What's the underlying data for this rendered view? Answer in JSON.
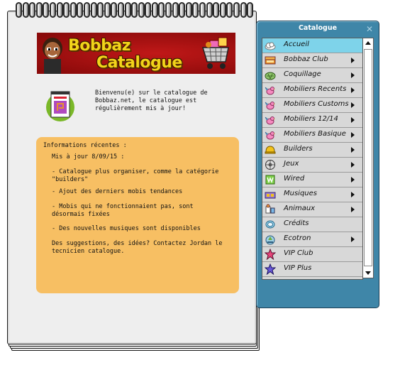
{
  "banner": {
    "title_line1": "Bobbaz",
    "title_line2": "Catalogue"
  },
  "intro": {
    "text": "Bienvenu(e) sur le catalogue de Bobbaz.net, le catalogue est régulièrement mis à jour!"
  },
  "news": {
    "title": "Informations récentes :",
    "date_line": "Mis à jour 8/09/15 :",
    "items": [
      "- Catalogue plus organiser, comme la catégorie \"builders\"",
      "- Ajout des derniers mobis tendances",
      "- Mobis qui ne fonctionnaient pas, sont désormais fixées",
      "- Des nouvelles musiques sont disponibles"
    ],
    "contact": "Des suggestions, des idées? Contactez Jordan le tecnicien catalogue."
  },
  "catalogue": {
    "title": "Catalogue",
    "close_icon": "close-icon",
    "accent_selected": "#7ed3ea",
    "window_color": "#3f86a8",
    "items": [
      {
        "label": "Accueil",
        "icon": "cloud-icon",
        "submenu": false,
        "selected": true
      },
      {
        "label": "Bobbaz Club",
        "icon": "club-sofa-icon",
        "submenu": true,
        "selected": false
      },
      {
        "label": "Coquillage",
        "icon": "shell-icon",
        "submenu": true,
        "selected": false
      },
      {
        "label": "Mobiliers Recents",
        "icon": "bird-icon",
        "submenu": true,
        "selected": false
      },
      {
        "label": "Mobiliers Customs",
        "icon": "bird-icon",
        "submenu": true,
        "selected": false
      },
      {
        "label": "Mobiliers 12/14",
        "icon": "bird-icon",
        "submenu": true,
        "selected": false
      },
      {
        "label": "Mobiliers Basique",
        "icon": "bird-icon",
        "submenu": true,
        "selected": false
      },
      {
        "label": "Builders",
        "icon": "builder-helmet-icon",
        "submenu": true,
        "selected": false
      },
      {
        "label": "Jeux",
        "icon": "ball-icon",
        "submenu": true,
        "selected": false
      },
      {
        "label": "Wired",
        "icon": "wired-icon",
        "submenu": true,
        "selected": false
      },
      {
        "label": "Musiques",
        "icon": "music-icon",
        "submenu": true,
        "selected": false
      },
      {
        "label": "Animaux",
        "icon": "pet-icon",
        "submenu": true,
        "selected": false
      },
      {
        "label": "Crédits",
        "icon": "coin-icon",
        "submenu": false,
        "selected": false
      },
      {
        "label": "Ecotron",
        "icon": "ecotron-icon",
        "submenu": true,
        "selected": false
      },
      {
        "label": "VIP Club",
        "icon": "star-icon",
        "submenu": false,
        "selected": false
      },
      {
        "label": "VIP Plus",
        "icon": "star-icon",
        "submenu": false,
        "selected": false
      }
    ]
  }
}
